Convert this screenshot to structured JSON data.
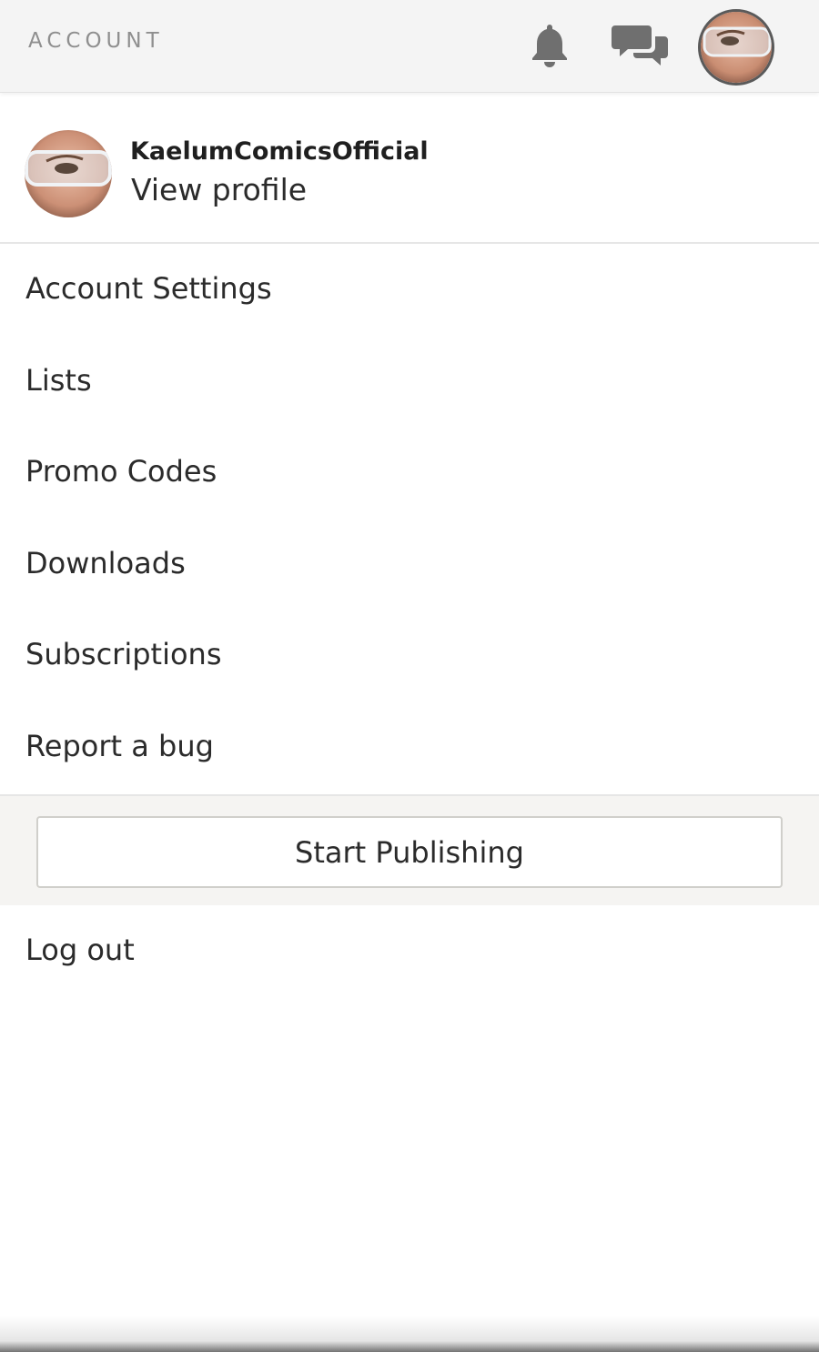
{
  "header": {
    "title": "ACCOUNT",
    "notifications_icon": "bell-icon",
    "messages_icon": "chat-bubbles-icon",
    "avatar_icon": "user-avatar"
  },
  "profile": {
    "username": "KaelumComicsOfficial",
    "view_profile_label": "View profile"
  },
  "menu": {
    "items": [
      {
        "label": "Account Settings"
      },
      {
        "label": "Lists"
      },
      {
        "label": "Promo Codes"
      },
      {
        "label": "Downloads"
      },
      {
        "label": "Subscriptions"
      },
      {
        "label": "Report a bug"
      }
    ]
  },
  "publish": {
    "button_label": "Start Publishing"
  },
  "logout": {
    "label": "Log out"
  }
}
